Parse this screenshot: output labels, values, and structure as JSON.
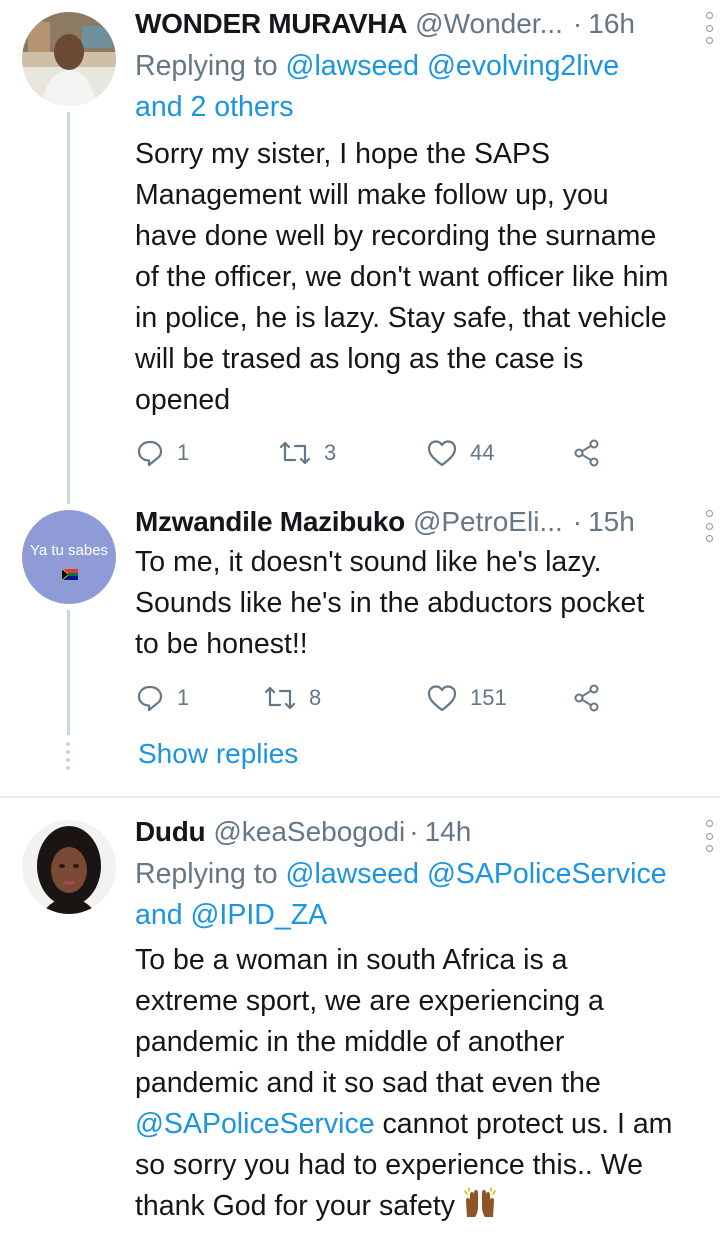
{
  "tweets": [
    {
      "display_name": "WONDER MURAVHA",
      "handle": "@Wonder...",
      "separator": "·",
      "time": "16h",
      "replying_prefix": "Replying to",
      "replying_1": "@lawseed",
      "replying_2": "@evolving2live",
      "replying_rest": "and 2 others",
      "body": [
        "Sorry my sister, I hope the SAPS",
        "Management will make follow up, you",
        "have done well by recording the surname",
        "of the officer, we don't want officer like him",
        "in police, he is lazy. Stay safe, that vehicle",
        "will be trased as long as the case is",
        "opened"
      ],
      "replies": "1",
      "retweets": "3",
      "likes": "44"
    },
    {
      "display_name": "Mzwandile Mazibuko",
      "handle": "@PetroEli...",
      "separator": "·",
      "time": "15h",
      "avatar_text": "Ya tu sabes",
      "body": [
        "To me, it doesn't sound like he's lazy.",
        "Sounds like he's in the abductors pocket",
        "to be honest!!"
      ],
      "replies": "1",
      "retweets": "8",
      "likes": "151"
    },
    {
      "display_name": "Dudu",
      "handle": "@keaSebogodi",
      "separator": "·",
      "time": "14h",
      "replying_prefix": "Replying to",
      "replying_1": "@lawseed",
      "replying_2": "@SAPoliceService",
      "replying_rest_prefix": "and",
      "replying_3": "@IPID_ZA",
      "body": [
        "To be a woman in south Africa is a",
        "extreme sport, we are experiencing a",
        "pandemic in the middle of another",
        "pandemic and it so sad that even the"
      ],
      "body_mention": "@SAPoliceService",
      "body_after_mention": " cannot protect us. I am",
      "body_tail": [
        "so sorry you had to experience this.. We",
        "thank God for your safety "
      ]
    }
  ],
  "show_replies_label": "Show replies",
  "colors": {
    "accent": "#1b95e0",
    "secondary_text": "#657786",
    "like_red": "#e0245e"
  },
  "icons": [
    "reply-icon",
    "retweet-icon",
    "like-icon",
    "share-icon",
    "more-options-icon",
    "raised-hands-emoji"
  ]
}
